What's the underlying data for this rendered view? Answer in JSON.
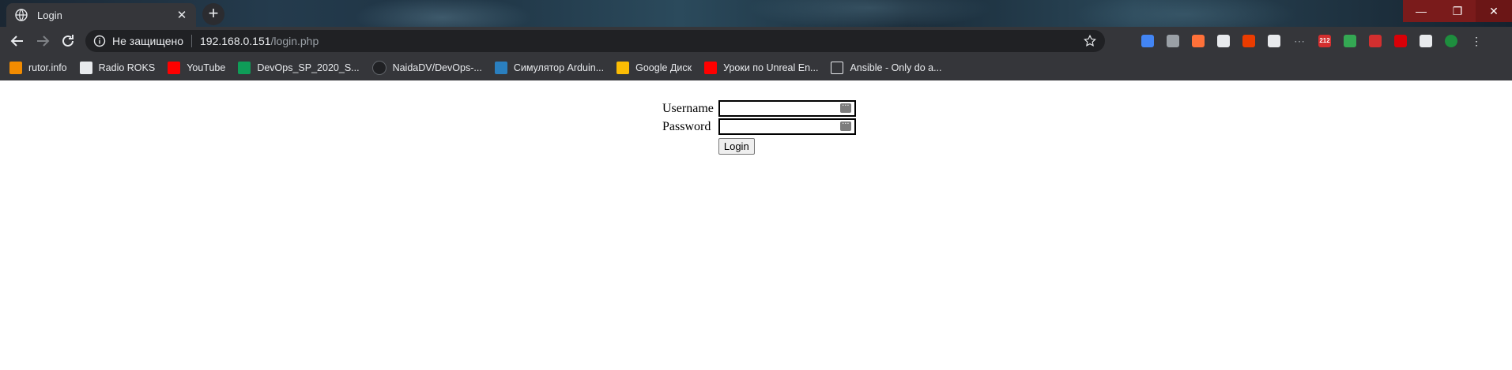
{
  "browser": {
    "tab": {
      "title": "Login",
      "close": "✕"
    },
    "new_tab": "+",
    "window_controls": {
      "minimize": "—",
      "maximize": "❐",
      "close": "✕"
    },
    "nav": {
      "back": "back-icon",
      "forward": "forward-icon",
      "reload": "reload-icon"
    },
    "address_bar": {
      "security_text": "Не защищено",
      "host": "192.168.0.151",
      "path": "/login.php"
    },
    "extensions": [
      {
        "name": "translate-icon",
        "color": "#4285f4"
      },
      {
        "name": "copy-icon",
        "color": "#9aa0a6"
      },
      {
        "name": "fox-icon",
        "color": "#ff7139"
      },
      {
        "name": "card-icon",
        "color": "#e8eaed"
      },
      {
        "name": "office-icon",
        "color": "#eb3c00"
      },
      {
        "name": "speed-icon",
        "color": "#e8eaed"
      },
      {
        "name": "dots-icon",
        "color": "#9aa0a6"
      },
      {
        "name": "yandex-212-icon",
        "color": "#d32f2f",
        "text": "212"
      },
      {
        "name": "shield-icon",
        "color": "#34a853"
      },
      {
        "name": "pdf-icon",
        "color": "#d32f2f"
      },
      {
        "name": "mega-icon",
        "color": "#d90007"
      },
      {
        "name": "puzzle-icon",
        "color": "#e8eaed"
      },
      {
        "name": "profile-avatar-icon",
        "color": "#1e8e3e"
      },
      {
        "name": "menu-icon",
        "color": "#e8eaed"
      }
    ],
    "bookmarks": [
      {
        "label": "rutor.info",
        "icon": "rutor-icon",
        "color": "#f28b00"
      },
      {
        "label": "Radio ROKS",
        "icon": "radio-icon",
        "color": "#e8eaed"
      },
      {
        "label": "YouTube",
        "icon": "youtube-icon",
        "color": "#ff0000"
      },
      {
        "label": "DevOps_SP_2020_S...",
        "icon": "sheets-icon",
        "color": "#0f9d58"
      },
      {
        "label": "NaidaDV/DevOps-...",
        "icon": "github-icon",
        "color": "#202124"
      },
      {
        "label": "Симулятор Arduin...",
        "icon": "tinkercad-icon",
        "color": "#2a7fbf"
      },
      {
        "label": "Google Диск",
        "icon": "drive-icon",
        "color": "#fbbc04"
      },
      {
        "label": "Уроки по Unreal En...",
        "icon": "youtube-icon",
        "color": "#ff0000"
      },
      {
        "label": "Ansible - Only do a...",
        "icon": "page-icon",
        "color": "#e8eaed"
      }
    ]
  },
  "page": {
    "form": {
      "username_label": "Username",
      "password_label": "Password",
      "username_value": "",
      "password_value": "",
      "submit_label": "Login"
    }
  }
}
